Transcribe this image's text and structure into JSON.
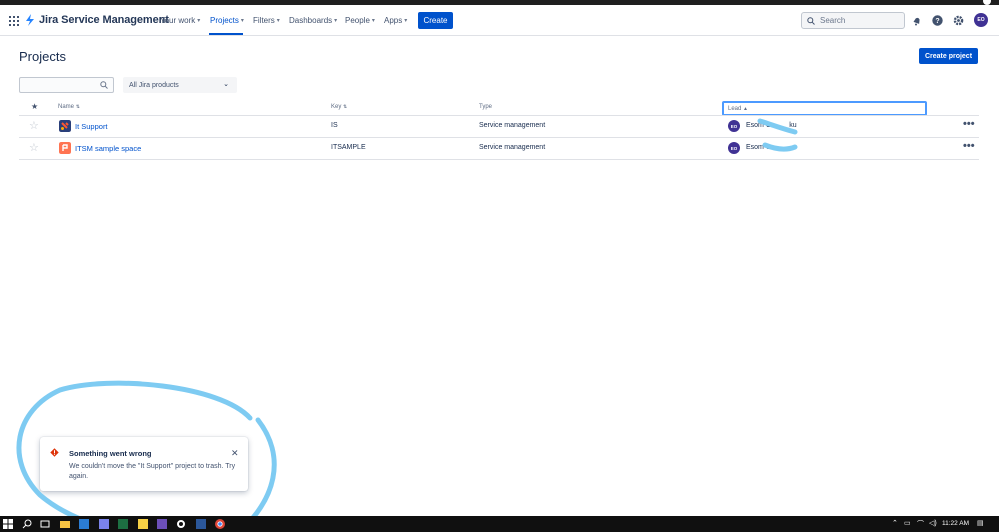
{
  "nav": {
    "logo_text": "Jira Service Management",
    "items": [
      {
        "label": "Your work"
      },
      {
        "label": "Projects"
      },
      {
        "label": "Filters"
      },
      {
        "label": "Dashboards"
      },
      {
        "label": "People"
      },
      {
        "label": "Apps"
      }
    ],
    "active_item": "Projects",
    "create_label": "Create",
    "search_placeholder": "Search",
    "avatar_initials": "EO"
  },
  "page": {
    "title": "Projects",
    "create_project_label": "Create project",
    "filter_search_value": "",
    "product_filter": "All Jira products"
  },
  "table": {
    "columns": {
      "name": "Name",
      "key": "Key",
      "type": "Type",
      "lead": "Lead"
    },
    "rows": [
      {
        "name": "It Support",
        "key": "IS",
        "type": "Service management",
        "lead_initials": "EO",
        "lead_name": "Esom O",
        "lead_name_tail": "ku"
      },
      {
        "name": "ITSM sample space",
        "key": "ITSAMPLE",
        "type": "Service management",
        "lead_initials": "EO",
        "lead_name": "Esom O",
        "lead_name_tail": ""
      }
    ]
  },
  "toast": {
    "title": "Something went wrong",
    "message": "We couldn't move the \"It Support\" project to trash. Try again."
  },
  "taskbar": {
    "time": "11:22 AM"
  },
  "colors": {
    "brand": "#0052cc",
    "avatar": "#403294",
    "scribble": "#7ecbf2",
    "error": "#de350b"
  }
}
